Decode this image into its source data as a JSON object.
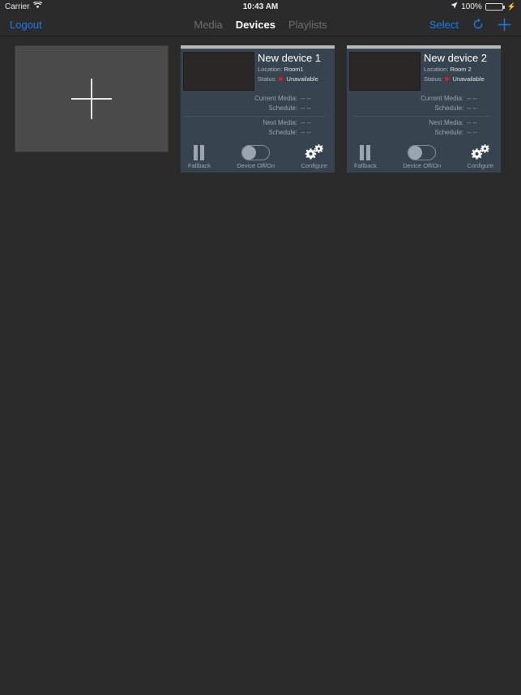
{
  "statusbar": {
    "carrier": "Carrier",
    "wifi_icon": "wifi-icon",
    "time": "10:43 AM",
    "location_icon": "location-arrow-icon",
    "battery_percent": "100%",
    "battery_level": 100,
    "charging_icon": "charging-bolt-icon"
  },
  "navbar": {
    "logout_label": "Logout",
    "tabs": [
      {
        "label": "Media",
        "active": false
      },
      {
        "label": "Devices",
        "active": true
      },
      {
        "label": "Playlists",
        "active": false
      }
    ],
    "select_label": "Select",
    "refresh_icon": "refresh-icon",
    "add_icon": "plus-icon",
    "accent_color": "#1a7cf0"
  },
  "add_tile": {
    "name": "add-device-tile",
    "icon": "plus-icon"
  },
  "labels": {
    "location": "Location:",
    "status": "Status:",
    "current_media": "Current Media:",
    "schedule": "Schedule:",
    "next_media": "Next Media:",
    "fallback": "Fallback",
    "device_toggle": "Device Off/On",
    "configure": "Configure"
  },
  "status_dot_color": "#e81a1a",
  "devices": [
    {
      "name": "New device 1",
      "location": "Room1",
      "status": "Unavailable",
      "current_media": "-- --",
      "current_schedule": "-- --",
      "next_media": "-- --",
      "next_schedule": "-- --",
      "toggle_on": false
    },
    {
      "name": "New device 2",
      "location": "Room 2",
      "status": "Unavailable",
      "current_media": "-- --",
      "current_schedule": "-- --",
      "next_media": "-- --",
      "next_schedule": "-- --",
      "toggle_on": false
    }
  ]
}
